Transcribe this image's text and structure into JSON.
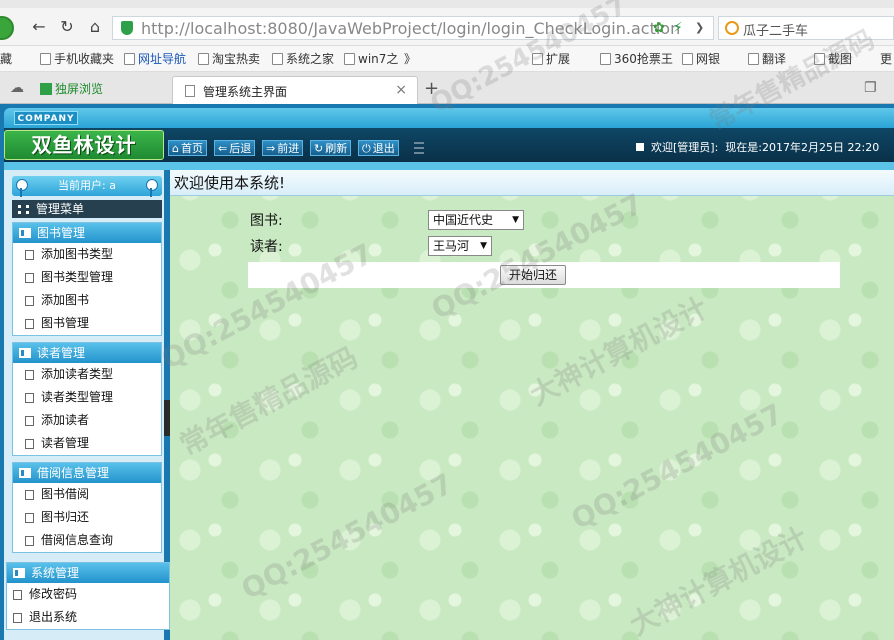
{
  "browser": {
    "address_url": "http://localhost:8080/JavaWebProject/login/login_CheckLogin.action",
    "search_text": "瓜子二手车",
    "bookmarks": [
      "藏",
      "手机收藏夹",
      "网址导航",
      "淘宝热卖",
      "系统之家",
      "win7之",
      "》",
      "扩展",
      "360抢票王",
      "网银",
      "翻译",
      "截图",
      "更"
    ],
    "split_tab_label": "独屏浏览",
    "active_tab_title": "管理系统主界面"
  },
  "header": {
    "company_label": "COMPANY",
    "logo_text": "双鱼林设计",
    "nav": [
      {
        "icon": "home-icon",
        "label": "首页"
      },
      {
        "icon": "back-icon",
        "label": "后退"
      },
      {
        "icon": "forward-icon",
        "label": "前进"
      },
      {
        "icon": "refresh-icon",
        "label": "刷新"
      },
      {
        "icon": "power-icon",
        "label": "退出"
      }
    ],
    "welcome_text": "欢迎[管理员]:",
    "time_text": "现在是:2017年2月25日 22:20"
  },
  "sidebar": {
    "current_user_label": "当前用户: a",
    "menu_title": "管理菜单",
    "groups": [
      {
        "title": "图书管理",
        "items": [
          "添加图书类型",
          "图书类型管理",
          "添加图书",
          "图书管理"
        ]
      },
      {
        "title": "读者管理",
        "items": [
          "添加读者类型",
          "读者类型管理",
          "添加读者",
          "读者管理"
        ]
      },
      {
        "title": "借阅信息管理",
        "items": [
          "图书借阅",
          "图书归还",
          "借阅信息查询"
        ]
      },
      {
        "title": "系统管理",
        "items": [
          "修改密码",
          "退出系统"
        ]
      }
    ]
  },
  "main": {
    "title": "欢迎使用本系统!",
    "form": {
      "book_label": "图书:",
      "book_value": "中国近代史",
      "reader_label": "读者:",
      "reader_value": "王马河",
      "submit_label": "开始归还"
    }
  },
  "watermarks": [
    "QQ:254540457",
    "大神计算机设计",
    "常年售精品源码"
  ]
}
